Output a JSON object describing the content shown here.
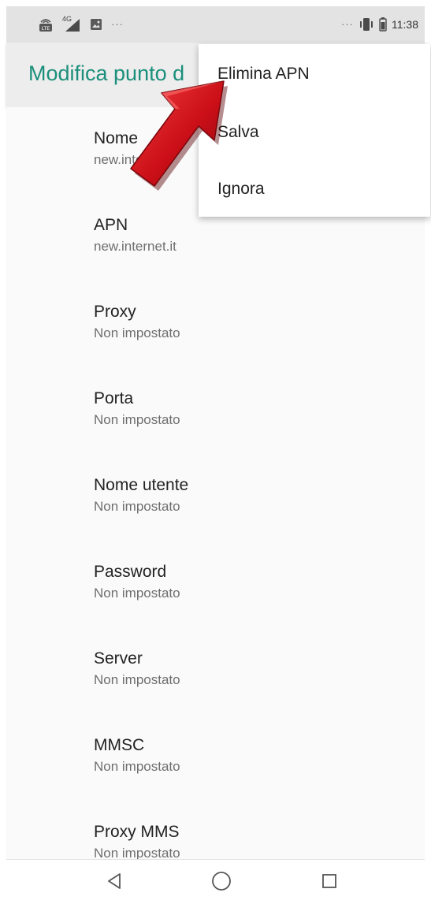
{
  "status_bar": {
    "left_icons": [
      "volte-icon",
      "signal-4g-icon",
      "image-notification-icon"
    ],
    "network_label": "4G",
    "left_more": "···",
    "right_more": "···",
    "time": "11:38"
  },
  "app_bar": {
    "title": "Modifica punto d",
    "title_color": "#1b8f7b"
  },
  "preferences": [
    {
      "title": "Nome",
      "summary": "new.internet"
    },
    {
      "title": "APN",
      "summary": "new.internet.it"
    },
    {
      "title": "Proxy",
      "summary": "Non impostato"
    },
    {
      "title": "Porta",
      "summary": "Non impostato"
    },
    {
      "title": "Nome utente",
      "summary": "Non impostato"
    },
    {
      "title": "Password",
      "summary": "Non impostato"
    },
    {
      "title": "Server",
      "summary": "Non impostato"
    },
    {
      "title": "MMSC",
      "summary": "Non impostato"
    },
    {
      "title": "Proxy MMS",
      "summary": "Non impostato"
    }
  ],
  "menu": {
    "items": [
      {
        "label": "Elimina APN"
      },
      {
        "label": "Salva"
      },
      {
        "label": "Ignora"
      }
    ]
  },
  "annotation": {
    "icon": "red-arrow-icon",
    "color": "#d0101a"
  },
  "nav_bar": {
    "icons": [
      "back-triangle-icon",
      "home-circle-icon",
      "recents-square-icon"
    ]
  }
}
